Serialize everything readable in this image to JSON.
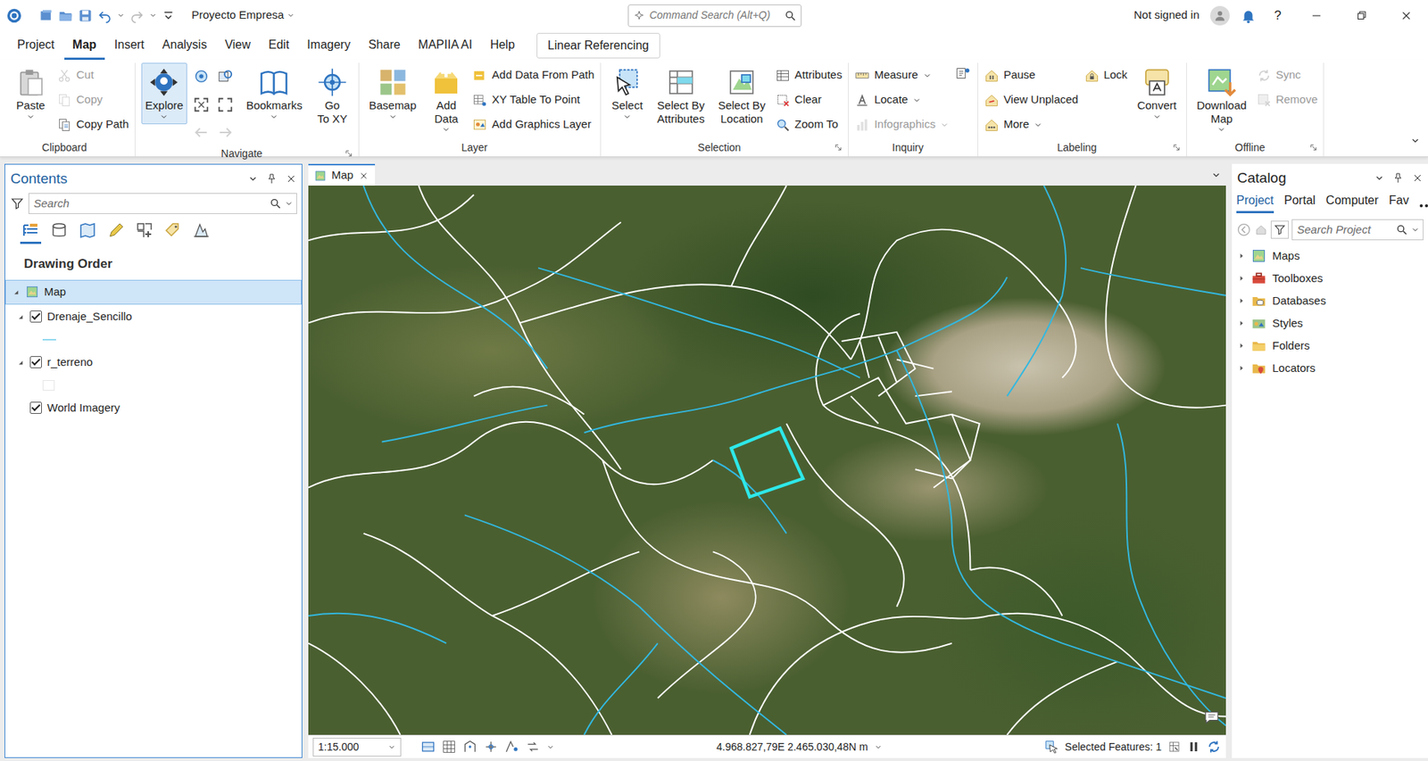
{
  "window": {
    "title": "Proyecto Empresa",
    "command_search": {
      "placeholder": "Command Search (Alt+Q)"
    },
    "account": "Not signed in",
    "help": "?"
  },
  "menu_tabs": [
    {
      "label": "Project",
      "selected": false
    },
    {
      "label": "Map",
      "selected": true
    },
    {
      "label": "Insert",
      "selected": false
    },
    {
      "label": "Analysis",
      "selected": false
    },
    {
      "label": "View",
      "selected": false
    },
    {
      "label": "Edit",
      "selected": false
    },
    {
      "label": "Imagery",
      "selected": false
    },
    {
      "label": "Share",
      "selected": false
    },
    {
      "label": "MAPIIA AI",
      "selected": false
    },
    {
      "label": "Help",
      "selected": false
    }
  ],
  "contextual_tab": {
    "label": "Linear Referencing"
  },
  "ribbon": {
    "groups": [
      {
        "label": "Clipboard",
        "launcher": false,
        "columns": [
          [
            {
              "kind": "large",
              "label": "Paste",
              "disabled": false,
              "active": false,
              "dropdown": true
            }
          ],
          [
            {
              "kind": "small",
              "label": "Cut",
              "disabled": true,
              "active": false,
              "dropdown": false
            },
            {
              "kind": "small",
              "label": "Copy",
              "disabled": true,
              "active": false,
              "dropdown": false
            },
            {
              "kind": "small",
              "label": "Copy Path",
              "disabled": false,
              "active": false,
              "dropdown": false
            }
          ]
        ]
      },
      {
        "label": "Navigate",
        "launcher": true,
        "columns": [
          [
            {
              "kind": "large",
              "label": "Explore",
              "disabled": false,
              "active": true,
              "dropdown": true
            }
          ],
          [
            {
              "kind": "icon",
              "disabled": false,
              "active": false
            },
            {
              "kind": "icon",
              "disabled": false,
              "active": false
            },
            {
              "kind": "icon",
              "disabled": false,
              "active": false
            },
            {
              "kind": "icon",
              "disabled": false,
              "active": false
            },
            {
              "kind": "icon",
              "disabled": true,
              "active": false
            },
            {
              "kind": "icon",
              "disabled": true,
              "active": false
            }
          ],
          [
            {
              "kind": "large",
              "label": "Bookmarks",
              "disabled": false,
              "active": false,
              "dropdown": true
            }
          ],
          [
            {
              "kind": "large",
              "label": "Go\nTo XY",
              "disabled": false,
              "active": false,
              "dropdown": false
            }
          ]
        ]
      },
      {
        "label": "Layer",
        "launcher": false,
        "columns": [
          [
            {
              "kind": "large",
              "label": "Basemap",
              "disabled": false,
              "active": false,
              "dropdown": true
            }
          ],
          [
            {
              "kind": "large",
              "label": "Add\nData",
              "disabled": false,
              "active": false,
              "dropdown": true
            }
          ],
          [
            {
              "kind": "small",
              "label": "Add Data From Path",
              "disabled": false,
              "active": false,
              "dropdown": false
            },
            {
              "kind": "small",
              "label": "XY Table To Point",
              "disabled": false,
              "active": false,
              "dropdown": false
            },
            {
              "kind": "small",
              "label": "Add Graphics Layer",
              "disabled": false,
              "active": false,
              "dropdown": false
            }
          ]
        ]
      },
      {
        "label": "Selection",
        "launcher": true,
        "columns": [
          [
            {
              "kind": "large",
              "label": "Select",
              "disabled": false,
              "active": false,
              "dropdown": true
            }
          ],
          [
            {
              "kind": "large",
              "label": "Select By\nAttributes",
              "disabled": false,
              "active": false,
              "dropdown": false
            }
          ],
          [
            {
              "kind": "large",
              "label": "Select By\nLocation",
              "disabled": false,
              "active": false,
              "dropdown": false
            }
          ],
          [
            {
              "kind": "small",
              "label": "Attributes",
              "disabled": false,
              "active": false,
              "dropdown": false
            },
            {
              "kind": "small",
              "label": "Clear",
              "disabled": false,
              "active": false,
              "dropdown": false
            },
            {
              "kind": "small",
              "label": "Zoom To",
              "disabled": false,
              "active": false,
              "dropdown": false
            }
          ]
        ]
      },
      {
        "label": "Inquiry",
        "launcher": false,
        "columns": [
          [
            {
              "kind": "small",
              "label": "Measure",
              "disabled": false,
              "active": false,
              "dropdown": true
            },
            {
              "kind": "small",
              "label": "Locate",
              "disabled": false,
              "active": false,
              "dropdown": true
            },
            {
              "kind": "small",
              "label": "Infographics",
              "disabled": true,
              "active": false,
              "dropdown": true
            }
          ],
          [
            {
              "kind": "icon",
              "disabled": false,
              "active": false
            }
          ]
        ]
      },
      {
        "label": "Labeling",
        "launcher": true,
        "columns": [
          [
            {
              "kind": "small",
              "label": "Pause",
              "disabled": false,
              "active": false,
              "dropdown": false
            },
            {
              "kind": "small",
              "label": "View Unplaced",
              "disabled": false,
              "active": false,
              "dropdown": false
            },
            {
              "kind": "small",
              "label": "More",
              "disabled": false,
              "active": false,
              "dropdown": true
            }
          ],
          [
            {
              "kind": "small",
              "label": "Lock",
              "disabled": false,
              "active": false,
              "dropdown": false
            }
          ],
          [
            {
              "kind": "large",
              "label": "Convert",
              "disabled": false,
              "active": false,
              "dropdown": true
            }
          ]
        ]
      },
      {
        "label": "Offline",
        "launcher": true,
        "columns": [
          [
            {
              "kind": "large",
              "label": "Download\nMap",
              "disabled": false,
              "active": false,
              "dropdown": true
            }
          ],
          [
            {
              "kind": "small",
              "label": "Sync",
              "disabled": true,
              "active": false,
              "dropdown": false
            },
            {
              "kind": "small",
              "label": "Remove",
              "disabled": true,
              "active": false,
              "dropdown": false
            }
          ]
        ]
      }
    ]
  },
  "contents": {
    "title": "Contents",
    "search": {
      "placeholder": "Search"
    },
    "views": [
      {
        "selected": true
      },
      {
        "selected": false
      },
      {
        "selected": false
      },
      {
        "selected": false
      },
      {
        "selected": false
      },
      {
        "selected": false
      },
      {
        "selected": false
      }
    ],
    "heading": "Drawing Order",
    "layers": [
      {
        "name": "Map",
        "kind": "map",
        "selected": true,
        "checked": true,
        "expanded": true
      },
      {
        "name": "Drenaje_Sencillo",
        "kind": "line",
        "selected": false,
        "checked": true,
        "expanded": true
      },
      {
        "name": "r_terreno",
        "kind": "polygon",
        "selected": false,
        "checked": true,
        "expanded": true
      },
      {
        "name": "World Imagery",
        "kind": "raster",
        "selected": false,
        "checked": true,
        "expanded": false
      }
    ]
  },
  "map_view": {
    "tab": "Map"
  },
  "status_bar": {
    "scale": "1:15.000",
    "coordinates": "4.968.827,79E 2.465.030,48N m",
    "selected_features": "Selected Features: 1"
  },
  "catalog": {
    "title": "Catalog",
    "tabs": [
      {
        "label": "Project",
        "selected": true
      },
      {
        "label": "Portal",
        "selected": false
      },
      {
        "label": "Computer",
        "selected": false
      },
      {
        "label": "Fav",
        "selected": false
      }
    ],
    "search": {
      "placeholder": "Search Project"
    },
    "items": [
      {
        "label": "Maps",
        "expanded": false
      },
      {
        "label": "Toolboxes",
        "expanded": false
      },
      {
        "label": "Databases",
        "expanded": false
      },
      {
        "label": "Styles",
        "expanded": false
      },
      {
        "label": "Folders",
        "expanded": false
      },
      {
        "label": "Locators",
        "expanded": false
      }
    ]
  }
}
